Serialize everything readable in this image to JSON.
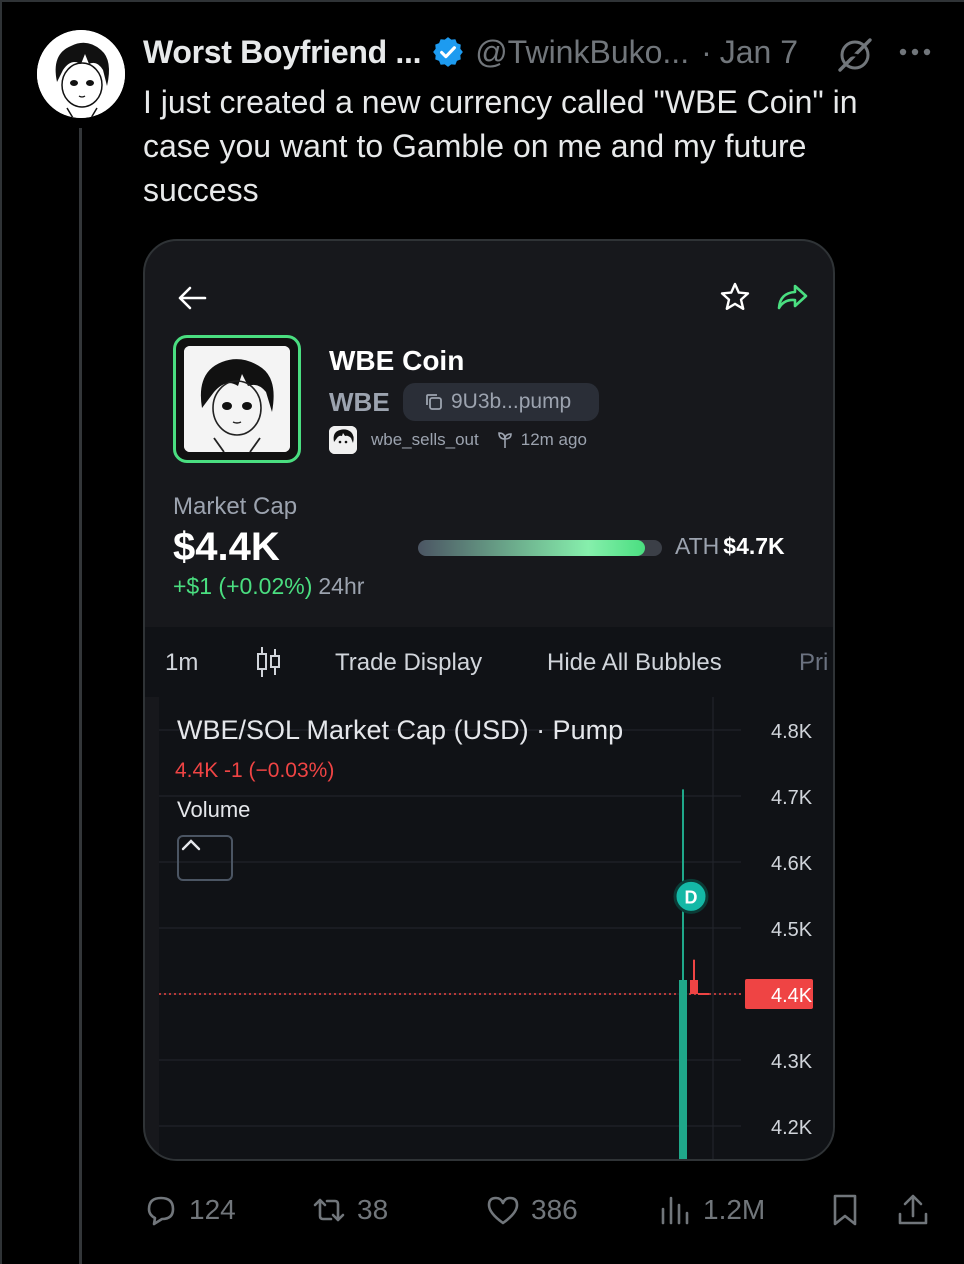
{
  "tweet": {
    "author_name": "Worst Boyfriend ...",
    "handle": "@TwinkBuko...",
    "separator": "·",
    "date": "Jan 7",
    "text": "I just created a new currency called \"WBE Coin\" in case you want to Gamble on me and my future success",
    "colors": {
      "background": "#000000",
      "text": "#e7e9ea",
      "muted": "#71767b",
      "verified": "#1d9bf0"
    }
  },
  "card": {
    "coin": {
      "name": "WBE Coin",
      "ticker": "WBE",
      "contract": "9U3b...pump",
      "creator": "wbe_sells_out",
      "age": "12m ago"
    },
    "market": {
      "label": "Market Cap",
      "value": "$4.4K",
      "change": "+$1 (+0.02%)",
      "period": "24hr",
      "ath_label": "ATH",
      "ath_value": "$4.7K",
      "progress_fraction": 0.93,
      "colors": {
        "positive": "#4ade80",
        "negative": "#ef4444"
      }
    },
    "toolbar": {
      "interval": "1m",
      "trade_display": "Trade Display",
      "hide_bubbles": "Hide All Bubbles",
      "overflow_text": "Pri"
    },
    "chart_header": {
      "title": "WBE/SOL Market Cap (USD) · Pump",
      "ohlc": "4.4K  -1 (−0.03%)",
      "volume": "Volume"
    }
  },
  "chart_data": {
    "type": "line",
    "title": "WBE/SOL Market Cap (USD) · Pump",
    "y_ticks": [
      "4.8K",
      "4.7K",
      "4.6K",
      "4.5K",
      "4.4K",
      "4.3K",
      "4.2K"
    ],
    "y_tick_values": [
      4800,
      4700,
      4600,
      4500,
      4400,
      4300,
      4200
    ],
    "ylim": [
      4150,
      4850
    ],
    "current_price_label": "4.4K",
    "current_price": 4400,
    "marker_label": "D",
    "marker_value": 4548,
    "candles": [
      {
        "open": 4400,
        "close": 4400,
        "high": 4710,
        "low": 4400,
        "direction": "up"
      },
      {
        "open": 4400,
        "close": 4410,
        "high": 4452,
        "low": 4395,
        "direction": "down"
      }
    ],
    "grid": true
  },
  "actions": {
    "replies": "124",
    "reposts": "38",
    "likes": "386",
    "views": "1.2M"
  }
}
